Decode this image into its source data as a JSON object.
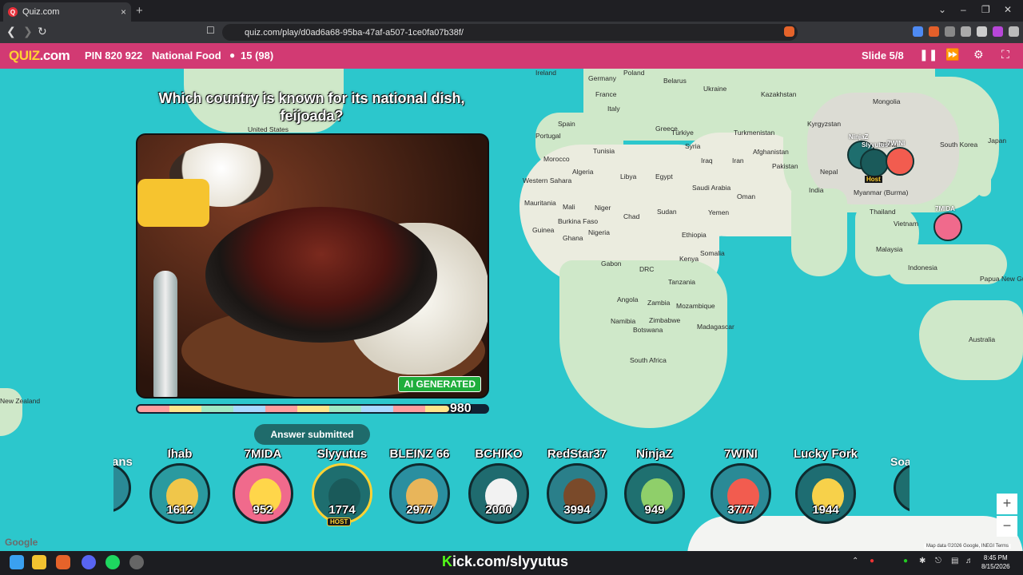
{
  "browser": {
    "tab_title": "Quiz.com",
    "tab_close": "×",
    "new_tab": "+",
    "url": "quiz.com/play/d0ad6a68-95ba-47af-a507-1ce0fa07b38f/",
    "controls": {
      "minimize": "⌄",
      "min": "–",
      "max": "❐",
      "close": "✕"
    }
  },
  "header": {
    "logo_q": "QUIZ",
    "logo_rest": ".com",
    "pin": "PIN 820 922",
    "quiz_name": "National Food",
    "players": "15 (98)",
    "slide": "Slide 5/8"
  },
  "question": "Which country is known for its national dish, feijoada?",
  "image_tag": "AI GENERATED",
  "timer": {
    "value": "980",
    "fraction": 0.89
  },
  "answered_label": "Answer submitted",
  "players": [
    {
      "name": "Ihab",
      "score": "1612",
      "color": "#2a9aa0",
      "face": "#f0c64a",
      "host": false
    },
    {
      "name": "7MIDA",
      "score": "952",
      "color": "#f06a8c",
      "face": "#ffd64a",
      "host": false
    },
    {
      "name": "Slyyutus",
      "score": "1774",
      "color": "#1e6e6f",
      "face": "#1a5a5a",
      "host": true,
      "host_label": "HOST"
    },
    {
      "name": "BLEINZ 66",
      "score": "2977",
      "color": "#2a8fa0",
      "face": "#e8b55a",
      "host": false
    },
    {
      "name": "BCHIKO",
      "score": "2000",
      "color": "#1f6b6f",
      "face": "#f2f2f2",
      "host": false
    },
    {
      "name": "RedStar37",
      "score": "3994",
      "color": "#2a7f8a",
      "face": "#7a4a2a",
      "host": false
    },
    {
      "name": "NinjaZ",
      "score": "949",
      "color": "#1f7070",
      "face": "#8fcf6a",
      "host": false
    },
    {
      "name": "7WINI",
      "score": "3777",
      "color": "#2a8a96",
      "face": "#f25c4f",
      "host": false
    },
    {
      "name": "Lucky Fork",
      "score": "1944",
      "color": "#1e6d72",
      "face": "#f7d14a",
      "host": false
    }
  ],
  "edge_left": "ans",
  "edge_right": "Soarta",
  "map_labels": [
    {
      "t": "Ireland"
    },
    {
      "t": "Germany"
    },
    {
      "t": "Poland"
    },
    {
      "t": "Belarus"
    },
    {
      "t": "Ukraine"
    },
    {
      "t": "France"
    },
    {
      "t": "Italy"
    },
    {
      "t": "Spain"
    },
    {
      "t": "Portugal"
    },
    {
      "t": "Greece"
    },
    {
      "t": "Türkiye"
    },
    {
      "t": "Tunisia"
    },
    {
      "t": "Morocco"
    },
    {
      "t": "Algeria"
    },
    {
      "t": "Libya"
    },
    {
      "t": "Egypt"
    },
    {
      "t": "Syria"
    },
    {
      "t": "Iraq"
    },
    {
      "t": "Iran"
    },
    {
      "t": "Saudi Arabia"
    },
    {
      "t": "Oman"
    },
    {
      "t": "Yemen"
    },
    {
      "t": "Western Sahara"
    },
    {
      "t": "Mauritania"
    },
    {
      "t": "Mali"
    },
    {
      "t": "Niger"
    },
    {
      "t": "Chad"
    },
    {
      "t": "Sudan"
    },
    {
      "t": "Guinea"
    },
    {
      "t": "Burkina Faso"
    },
    {
      "t": "Ghana"
    },
    {
      "t": "Nigeria"
    },
    {
      "t": "Ethiopia"
    },
    {
      "t": "Somalia"
    },
    {
      "t": "Gabon"
    },
    {
      "t": "DRC"
    },
    {
      "t": "Kenya"
    },
    {
      "t": "Tanzania"
    },
    {
      "t": "Angola"
    },
    {
      "t": "Zambia"
    },
    {
      "t": "Mozambique"
    },
    {
      "t": "Namibia"
    },
    {
      "t": "Zimbabwe"
    },
    {
      "t": "Botswana"
    },
    {
      "t": "Madagascar"
    },
    {
      "t": "South Africa"
    },
    {
      "t": "Kazakhstan"
    },
    {
      "t": "Turkmenistan"
    },
    {
      "t": "Afghanistan"
    },
    {
      "t": "Pakistan"
    },
    {
      "t": "India"
    },
    {
      "t": "Nepal"
    },
    {
      "t": "Kyrgyzstan"
    },
    {
      "t": "Mongolia"
    },
    {
      "t": "China"
    },
    {
      "t": "South Korea"
    },
    {
      "t": "Japan"
    },
    {
      "t": "Myanmar (Burma)"
    },
    {
      "t": "Thailand"
    },
    {
      "t": "Vietnam"
    },
    {
      "t": "Malaysia"
    },
    {
      "t": "Indonesia"
    },
    {
      "t": "Papua New Guinea"
    },
    {
      "t": "Australia"
    },
    {
      "t": "United States"
    },
    {
      "t": "New Zealand"
    }
  ],
  "map_markers": [
    {
      "name": "NinjaZ",
      "color": "#1e6e6e"
    },
    {
      "name": "Slyyutus",
      "color": "#1a5a5a"
    },
    {
      "name": "7WINI",
      "color": "#f25c4f"
    },
    {
      "name": "7MIDA",
      "color": "#f06a8c"
    }
  ],
  "marker_host": "Host",
  "zoom_in": "+",
  "zoom_out": "−",
  "google": "Google",
  "attribution": "Map data ©2026 Google, INEGI   Terms",
  "taskbar": {
    "kick_k": "K",
    "kick_rest": "ick.com/slyyutus",
    "time": "8:45 PM",
    "date": "8/15/2026"
  }
}
